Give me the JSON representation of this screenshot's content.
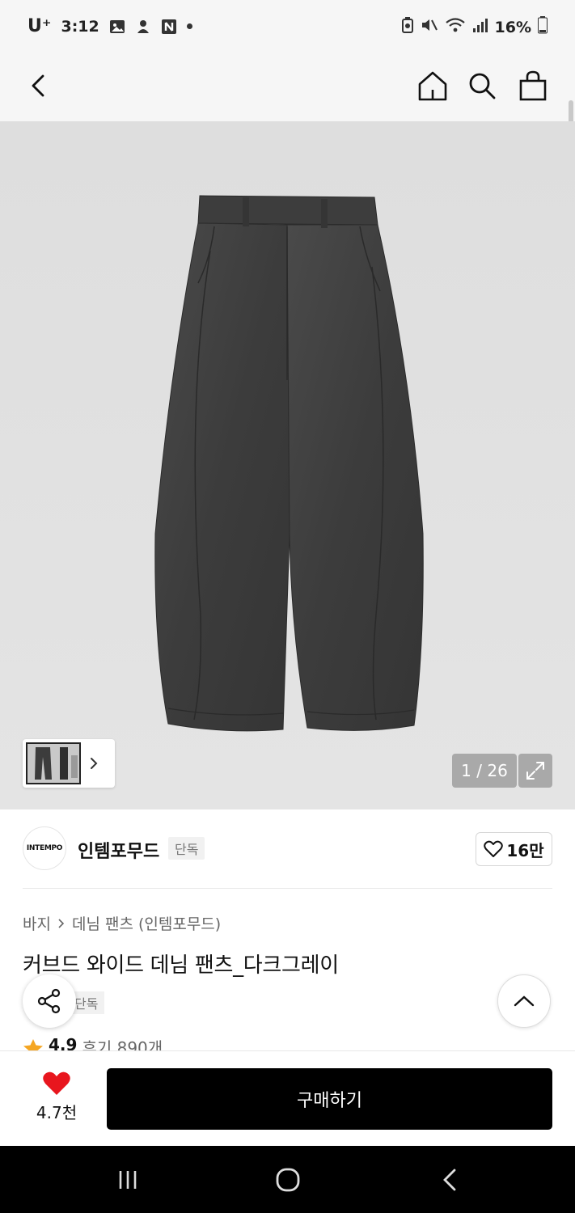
{
  "status_bar": {
    "carrier": "U⁺",
    "time": "3:12",
    "battery": "16%"
  },
  "nav": {
    "back_icon": "chevron-left-icon",
    "home_icon": "home-icon",
    "search_icon": "search-icon",
    "bag_icon": "shopping-bag-icon"
  },
  "gallery": {
    "counter": "1 / 26",
    "expand_icon": "expand-icon"
  },
  "brand": {
    "logo_text": "INTEMPO",
    "name": "인템포무드",
    "badge": "단독",
    "likes": "16만"
  },
  "product": {
    "breadcrumb": [
      "바지",
      "데님 팬츠 (인템포무드)"
    ],
    "title": "커브드 와이드 데님 팬츠_다크그레이",
    "badge": "단독",
    "rating": "4.9",
    "reviews": "후기 890개"
  },
  "bottom": {
    "wish_count": "4.7천",
    "buy_label": "구매하기"
  },
  "colors": {
    "accent_red": "#e8161e",
    "rating_star": "#f5a623",
    "buy_bg": "#000000"
  }
}
